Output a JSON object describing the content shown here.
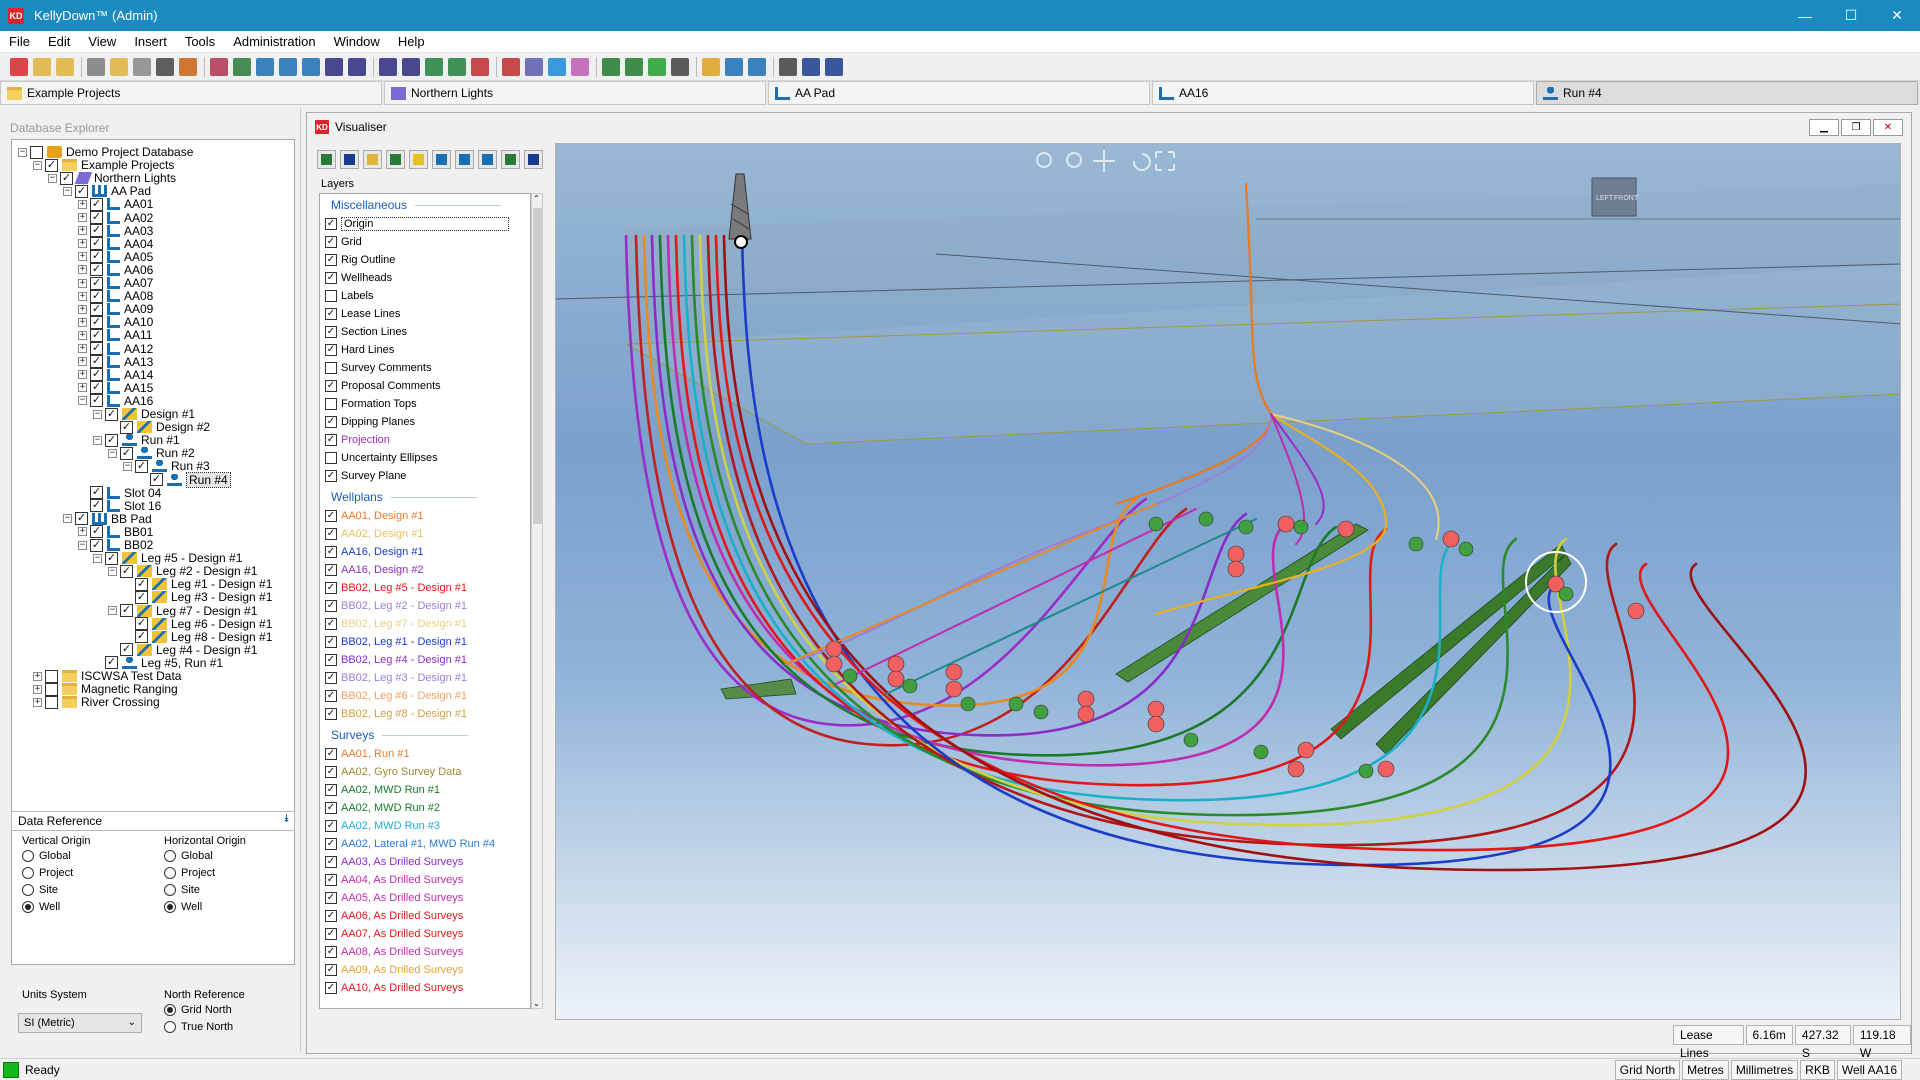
{
  "window": {
    "app_icon": "KD",
    "title": "KellyDown™ (Admin)",
    "minimize": "—",
    "maximize": "☐",
    "close": "✕"
  },
  "menu": [
    "File",
    "Edit",
    "View",
    "Insert",
    "Tools",
    "Administration",
    "Window",
    "Help"
  ],
  "doc_tabs": [
    "Example Projects",
    "Northern Lights",
    "AA Pad",
    "AA16",
    "Run #4"
  ],
  "explorer": {
    "title": "Database Explorer",
    "nodes": [
      {
        "label": "Demo Project Database",
        "icon": "database-icon",
        "expander": "-",
        "checked": false
      },
      {
        "label": "Example Projects",
        "icon": "folder-icon",
        "expander": "-",
        "checked": true
      },
      {
        "label": "Northern Lights",
        "icon": "site-icon",
        "expander": "-",
        "checked": true
      },
      {
        "label": "AA Pad",
        "icon": "pad-icon",
        "expander": "-",
        "checked": true
      },
      {
        "label": "AA01",
        "icon": "well-icon",
        "expander": "+",
        "checked": true
      },
      {
        "label": "AA02",
        "icon": "well-icon",
        "expander": "+",
        "checked": true
      },
      {
        "label": "AA03",
        "icon": "well-icon",
        "expander": "+",
        "checked": true
      },
      {
        "label": "AA04",
        "icon": "well-icon",
        "expander": "+",
        "checked": true
      },
      {
        "label": "AA05",
        "icon": "well-icon",
        "expander": "+",
        "checked": true
      },
      {
        "label": "AA06",
        "icon": "well-icon",
        "expander": "+",
        "checked": true
      },
      {
        "label": "AA07",
        "icon": "well-icon",
        "expander": "+",
        "checked": true
      },
      {
        "label": "AA08",
        "icon": "well-icon",
        "expander": "+",
        "checked": true
      },
      {
        "label": "AA09",
        "icon": "well-icon",
        "expander": "+",
        "checked": true
      },
      {
        "label": "AA10",
        "icon": "well-icon",
        "expander": "+",
        "checked": true
      },
      {
        "label": "AA11",
        "icon": "well-icon",
        "expander": "+",
        "checked": true
      },
      {
        "label": "AA12",
        "icon": "well-icon",
        "expander": "+",
        "checked": true
      },
      {
        "label": "AA13",
        "icon": "well-icon",
        "expander": "+",
        "checked": true
      },
      {
        "label": "AA14",
        "icon": "well-icon",
        "expander": "+",
        "checked": true
      },
      {
        "label": "AA15",
        "icon": "well-icon",
        "expander": "+",
        "checked": true
      },
      {
        "label": "AA16",
        "icon": "well-icon",
        "expander": "-",
        "checked": true
      },
      {
        "label": "Design #1",
        "icon": "plan-icon",
        "expander": "-",
        "checked": true
      },
      {
        "label": "Design #2",
        "icon": "plan-icon",
        "expander": "",
        "checked": true
      },
      {
        "label": "Run #1",
        "icon": "run-icon",
        "expander": "-",
        "checked": true
      },
      {
        "label": "Run #2",
        "icon": "run-icon",
        "expander": "-",
        "checked": true
      },
      {
        "label": "Run #3",
        "icon": "run-icon",
        "expander": "-",
        "checked": true
      },
      {
        "label": "Run #4",
        "icon": "run-icon",
        "expander": "",
        "checked": true
      },
      {
        "label": "Slot 04",
        "icon": "well-icon",
        "expander": "",
        "checked": true
      },
      {
        "label": "Slot 16",
        "icon": "well-icon",
        "expander": "",
        "checked": true
      },
      {
        "label": "BB Pad",
        "icon": "pad-icon",
        "expander": "-",
        "checked": true
      },
      {
        "label": "BB01",
        "icon": "well-icon",
        "expander": "+",
        "checked": true
      },
      {
        "label": "BB02",
        "icon": "well-icon",
        "expander": "-",
        "checked": true
      },
      {
        "label": "Leg #5 - Design #1",
        "icon": "plan-icon",
        "expander": "-",
        "checked": true
      },
      {
        "label": "Leg #2 - Design #1",
        "icon": "plan-icon",
        "expander": "-",
        "checked": true
      },
      {
        "label": "Leg #1 - Design #1",
        "icon": "plan-icon",
        "expander": "",
        "checked": true
      },
      {
        "label": "Leg #3 - Design #1",
        "icon": "plan-icon",
        "expander": "",
        "checked": true
      },
      {
        "label": "Leg #7 - Design #1",
        "icon": "plan-icon",
        "expander": "-",
        "checked": true
      },
      {
        "label": "Leg #6 - Design #1",
        "icon": "plan-icon",
        "expander": "",
        "checked": true
      },
      {
        "label": "Leg #8 - Design #1",
        "icon": "plan-icon",
        "expander": "",
        "checked": true
      },
      {
        "label": "Leg #4 - Design #1",
        "icon": "plan-icon",
        "expander": "",
        "checked": true
      },
      {
        "label": "Leg #5, Run #1",
        "icon": "run-icon",
        "expander": "",
        "checked": true
      },
      {
        "label": "ISCWSA Test Data",
        "icon": "folder-icon",
        "expander": "+",
        "checked": false
      },
      {
        "label": "Magnetic Ranging",
        "icon": "folder-icon",
        "expander": "+",
        "checked": false
      },
      {
        "label": "River Crossing",
        "icon": "folder-icon",
        "expander": "+",
        "checked": false
      }
    ]
  },
  "data_reference": {
    "title": "Data Reference",
    "vertical_origin": {
      "title": "Vertical Origin",
      "options": [
        "Global",
        "Project",
        "Site",
        "Well"
      ],
      "selected": "Well"
    },
    "horizontal_origin": {
      "title": "Horizontal Origin",
      "options": [
        "Global",
        "Project",
        "Site",
        "Well"
      ],
      "selected": "Well"
    },
    "units_system": {
      "title": "Units System",
      "value": "SI (Metric)"
    },
    "north_reference": {
      "title": "North Reference",
      "options": [
        "Grid North",
        "True North"
      ],
      "selected": "Grid North"
    }
  },
  "visualiser": {
    "title": "Visualiser",
    "layers_heading": "Layers",
    "sections": [
      {
        "name": "Miscellaneous",
        "items": [
          {
            "label": "Origin",
            "checked": true,
            "color": "#000000"
          },
          {
            "label": "Grid",
            "checked": true,
            "color": "#000000"
          },
          {
            "label": "Rig Outline",
            "checked": true,
            "color": "#000000"
          },
          {
            "label": "Wellheads",
            "checked": true,
            "color": "#000000"
          },
          {
            "label": "Labels",
            "checked": false,
            "color": "#000000"
          },
          {
            "label": "Lease Lines",
            "checked": true,
            "color": "#000000"
          },
          {
            "label": "Section Lines",
            "checked": true,
            "color": "#000000"
          },
          {
            "label": "Hard Lines",
            "checked": true,
            "color": "#000000"
          },
          {
            "label": "Survey Comments",
            "checked": false,
            "color": "#000000"
          },
          {
            "label": "Proposal Comments",
            "checked": true,
            "color": "#000000"
          },
          {
            "label": "Formation Tops",
            "checked": false,
            "color": "#000000"
          },
          {
            "label": "Dipping Planes",
            "checked": true,
            "color": "#000000"
          },
          {
            "label": "Projection",
            "checked": true,
            "color": "#9b30c0"
          },
          {
            "label": "Uncertainty Ellipses",
            "checked": false,
            "color": "#000000"
          },
          {
            "label": "Survey Plane",
            "checked": true,
            "color": "#000000"
          }
        ]
      },
      {
        "name": "Wellplans",
        "items": [
          {
            "label": "AA01, Design #1",
            "checked": true,
            "color": "#e87a2a"
          },
          {
            "label": "AA02, Design #1",
            "checked": true,
            "color": "#e8c060"
          },
          {
            "label": "AA16, Design #1",
            "checked": true,
            "color": "#1a3cc8"
          },
          {
            "label": "AA16, Design #2",
            "checked": true,
            "color": "#8a2cc8"
          },
          {
            "label": "BB02, Leg #5 - Design #1",
            "checked": true,
            "color": "#e01818"
          },
          {
            "label": "BB02, Leg #2 - Design #1",
            "checked": true,
            "color": "#9a80d8"
          },
          {
            "label": "BB02, Leg #7 - Design #1",
            "checked": true,
            "color": "#e8d080"
          },
          {
            "label": "BB02, Leg #1 - Design #1",
            "checked": true,
            "color": "#1a3cc8"
          },
          {
            "label": "BB02, Leg #4 - Design #1",
            "checked": true,
            "color": "#8a2cc8"
          },
          {
            "label": "BB02, Leg #3 - Design #1",
            "checked": true,
            "color": "#9a80d8"
          },
          {
            "label": "BB02, Leg #6 - Design #1",
            "checked": true,
            "color": "#f0a060"
          },
          {
            "label": "BB02, Leg #8 - Design #1",
            "checked": true,
            "color": "#d0a040"
          }
        ]
      },
      {
        "name": "Surveys",
        "items": [
          {
            "label": "AA01, Run #1",
            "checked": true,
            "color": "#e87a2a"
          },
          {
            "label": "AA02, Gyro Survey Data",
            "checked": true,
            "color": "#a08a30"
          },
          {
            "label": "AA02, MWD Run #1",
            "checked": true,
            "color": "#1a7a2a"
          },
          {
            "label": "AA02, MWD Run #2",
            "checked": true,
            "color": "#1a7a2a"
          },
          {
            "label": "AA02, MWD Run #3",
            "checked": true,
            "color": "#1ab0e0"
          },
          {
            "label": "AA02, Lateral #1, MWD Run #4",
            "checked": true,
            "color": "#2a7ad8"
          },
          {
            "label": "AA03, As Drilled Surveys",
            "checked": true,
            "color": "#8a2cc8"
          },
          {
            "label": "AA04, As Drilled Surveys",
            "checked": true,
            "color": "#c02cb0"
          },
          {
            "label": "AA05, As Drilled Surveys",
            "checked": true,
            "color": "#c02cb0"
          },
          {
            "label": "AA06, As Drilled Surveys",
            "checked": true,
            "color": "#e01818"
          },
          {
            "label": "AA07, As Drilled Surveys",
            "checked": true,
            "color": "#e01818"
          },
          {
            "label": "AA08, As Drilled Surveys",
            "checked": true,
            "color": "#c02cb0"
          },
          {
            "label": "AA09, As Drilled Surveys",
            "checked": true,
            "color": "#e8a030"
          },
          {
            "label": "AA10, As Drilled Surveys",
            "checked": true,
            "color": "#e01818"
          }
        ]
      }
    ],
    "status": [
      "Lease Lines",
      "6.16m",
      "427.32 S",
      "119.18 W"
    ],
    "cube_labels": [
      "LEFT",
      "FRONT"
    ]
  },
  "statusbar": {
    "ready": "Ready",
    "cells": [
      "Grid North",
      "Metres",
      "Millimetres",
      "RKB",
      "Well AA16"
    ]
  }
}
